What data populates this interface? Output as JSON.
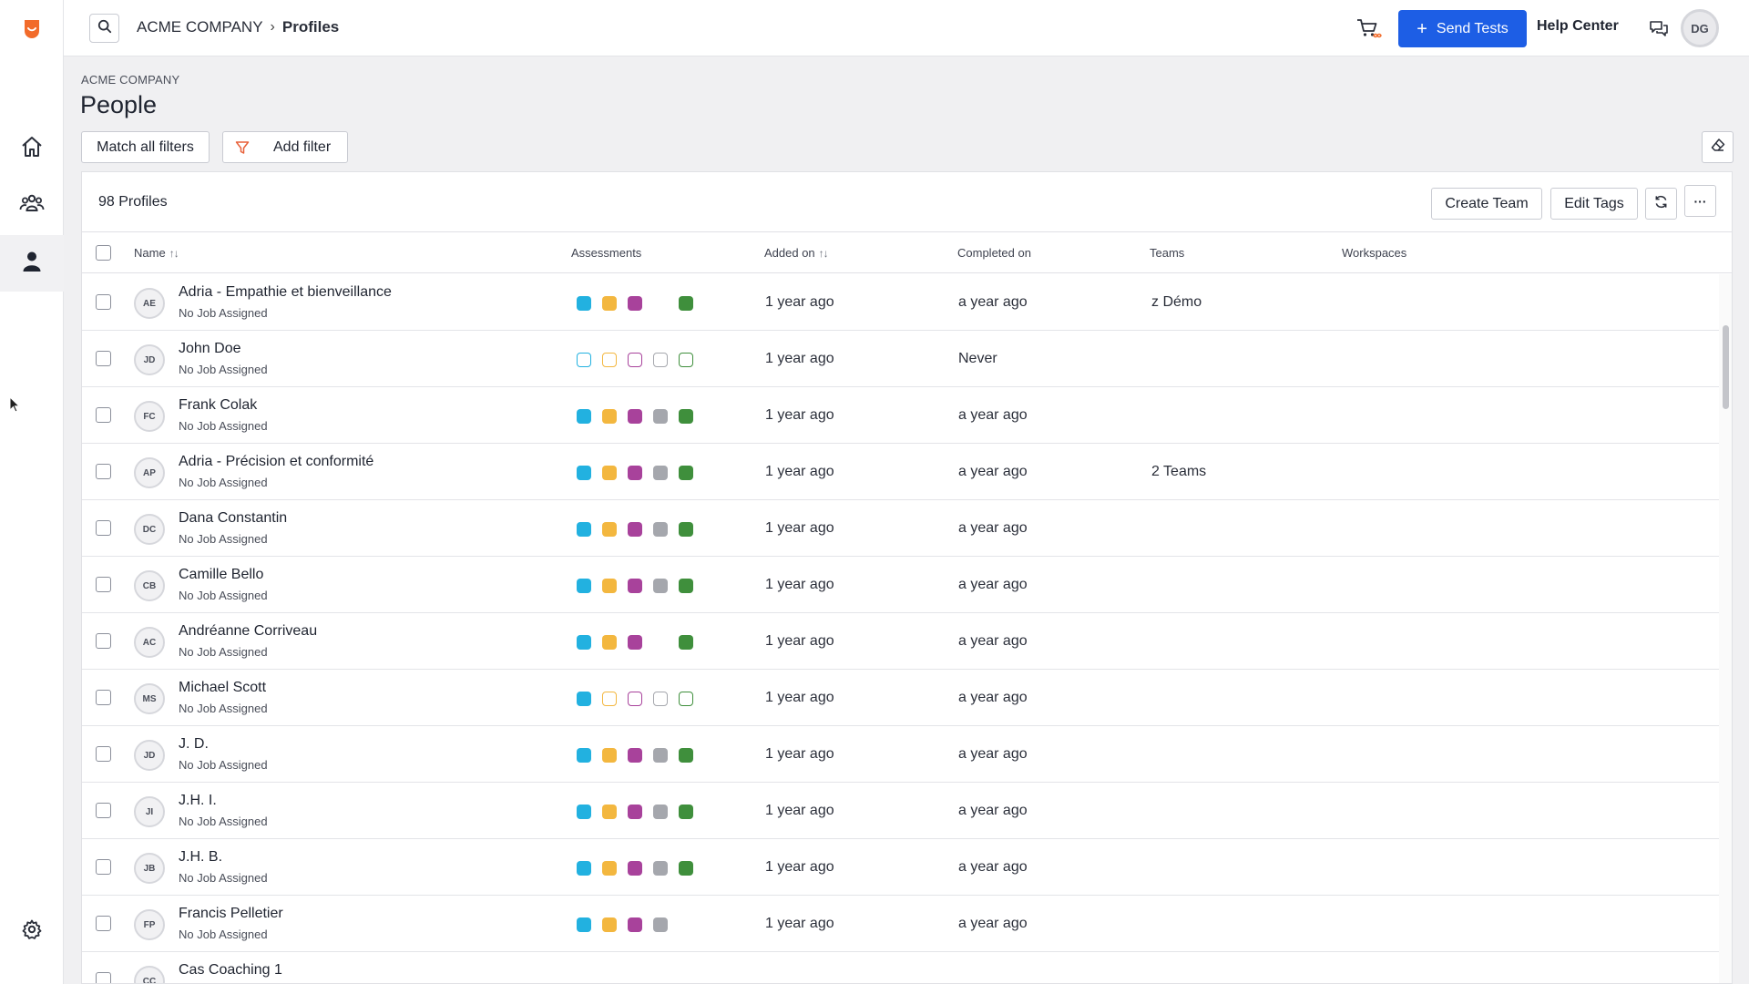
{
  "topbar": {
    "breadcrumb": [
      "ACME COMPANY",
      "Profiles"
    ],
    "send_tests_label": "Send Tests",
    "help_center_label": "Help Center",
    "user_initials": "DG"
  },
  "header": {
    "company": "ACME COMPANY",
    "title": "People",
    "match_filters_label": "Match all filters",
    "add_filter_label": "Add filter"
  },
  "panel": {
    "profiles_count": "98 Profiles",
    "create_team_label": "Create Team",
    "edit_tags_label": "Edit Tags",
    "more_label": "···"
  },
  "columns": {
    "name": "Name",
    "name_sort": "↑↓",
    "assessments": "Assessments",
    "added_on": "Added on",
    "added_sort": "↑↓",
    "completed_on": "Completed on",
    "teams": "Teams",
    "workspaces": "Workspaces"
  },
  "colors": {
    "accent": "#1d5ee5",
    "assessment": [
      "#22b1e0",
      "#f3b73f",
      "#a8429b",
      "#a5a7ad",
      "#3f8f3c"
    ],
    "logo": "#f26b2a"
  },
  "rows": [
    {
      "initials": "AE",
      "name": "Adria - Empathie et bienveillance",
      "job": "No Job Assigned",
      "assess": [
        "filled",
        "filled",
        "filled",
        "none",
        "filled"
      ],
      "added": "1 year ago",
      "completed": "a year ago",
      "teams": "z Démo"
    },
    {
      "initials": "JD",
      "name": "John Doe",
      "job": "No Job Assigned",
      "assess": [
        "empty",
        "empty",
        "empty",
        "empty",
        "empty"
      ],
      "added": "1 year ago",
      "completed": "Never",
      "teams": ""
    },
    {
      "initials": "FC",
      "name": "Frank Colak",
      "job": "No Job Assigned",
      "assess": [
        "filled",
        "filled",
        "filled",
        "filled",
        "filled"
      ],
      "added": "1 year ago",
      "completed": "a year ago",
      "teams": ""
    },
    {
      "initials": "AP",
      "name": "Adria - Précision et conformité",
      "job": "No Job Assigned",
      "assess": [
        "filled",
        "filled",
        "filled",
        "filled",
        "filled"
      ],
      "added": "1 year ago",
      "completed": "a year ago",
      "teams": "2 Teams"
    },
    {
      "initials": "DC",
      "name": "Dana Constantin",
      "job": "No Job Assigned",
      "assess": [
        "filled",
        "filled",
        "filled",
        "filled",
        "filled"
      ],
      "added": "1 year ago",
      "completed": "a year ago",
      "teams": ""
    },
    {
      "initials": "CB",
      "name": "Camille Bello",
      "job": "No Job Assigned",
      "assess": [
        "filled",
        "filled",
        "filled",
        "filled",
        "filled"
      ],
      "added": "1 year ago",
      "completed": "a year ago",
      "teams": ""
    },
    {
      "initials": "AC",
      "name": "Andréanne Corriveau",
      "job": "No Job Assigned",
      "assess": [
        "filled",
        "filled",
        "filled",
        "none",
        "filled"
      ],
      "added": "1 year ago",
      "completed": "a year ago",
      "teams": ""
    },
    {
      "initials": "MS",
      "name": "Michael Scott",
      "job": "No Job Assigned",
      "assess": [
        "filled",
        "empty",
        "empty",
        "empty",
        "empty"
      ],
      "added": "1 year ago",
      "completed": "a year ago",
      "teams": ""
    },
    {
      "initials": "JD",
      "name": "J. D.",
      "job": "No Job Assigned",
      "assess": [
        "filled",
        "filled",
        "filled",
        "filled",
        "filled"
      ],
      "added": "1 year ago",
      "completed": "a year ago",
      "teams": ""
    },
    {
      "initials": "JI",
      "name": "J.H. I.",
      "job": "No Job Assigned",
      "assess": [
        "filled",
        "filled",
        "filled",
        "filled",
        "filled"
      ],
      "added": "1 year ago",
      "completed": "a year ago",
      "teams": ""
    },
    {
      "initials": "JB",
      "name": "J.H. B.",
      "job": "No Job Assigned",
      "assess": [
        "filled",
        "filled",
        "filled",
        "filled",
        "filled"
      ],
      "added": "1 year ago",
      "completed": "a year ago",
      "teams": ""
    },
    {
      "initials": "FP",
      "name": "Francis Pelletier",
      "job": "No Job Assigned",
      "assess": [
        "filled",
        "filled",
        "filled",
        "filled",
        "none"
      ],
      "added": "1 year ago",
      "completed": "a year ago",
      "teams": ""
    },
    {
      "initials": "CC",
      "name": "Cas Coaching 1",
      "job": "",
      "assess": [
        "none",
        "none",
        "none",
        "none",
        "none"
      ],
      "added": "",
      "completed": "",
      "teams": ""
    }
  ]
}
